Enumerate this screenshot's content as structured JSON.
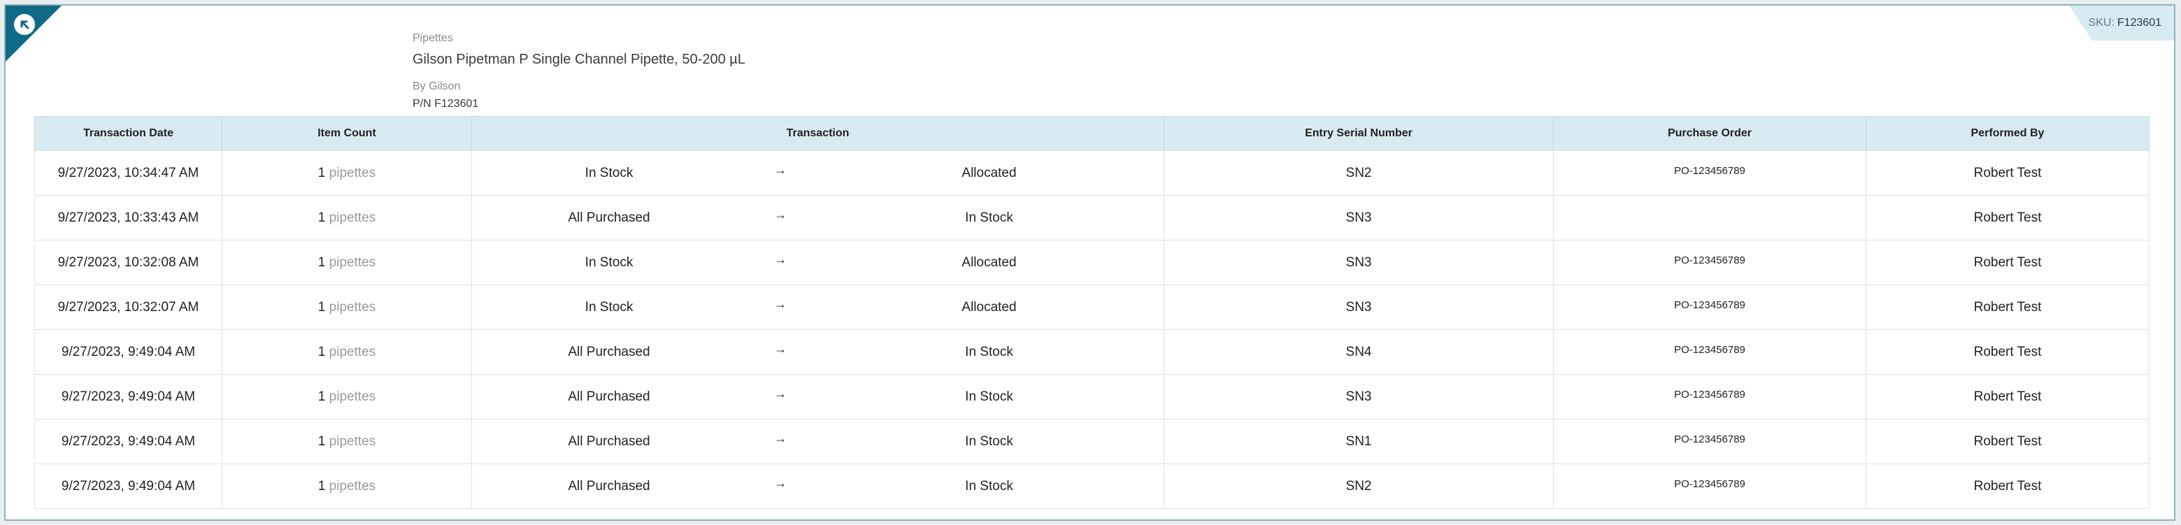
{
  "sku": {
    "label": "SKU:",
    "value": "F123601"
  },
  "product": {
    "category": "Pipettes",
    "name": "Gilson Pipetman P Single Channel Pipette, 50-200 µL",
    "by": "By Gilson",
    "pn": "P/N F123601"
  },
  "table": {
    "headers": [
      "Transaction Date",
      "Item Count",
      "Transaction",
      "Entry Serial Number",
      "Purchase Order",
      "Performed By"
    ],
    "rows": [
      {
        "date": "9/27/2023, 10:34:47 AM",
        "count": "1",
        "unit": "pipettes",
        "from": "In Stock",
        "arrow": "→",
        "to": "Allocated",
        "serial": "SN2",
        "po": "PO-123456789",
        "by": "Robert Test"
      },
      {
        "date": "9/27/2023, 10:33:43 AM",
        "count": "1",
        "unit": "pipettes",
        "from": "All Purchased",
        "arrow": "→",
        "to": "In Stock",
        "serial": "SN3",
        "po": "",
        "by": "Robert Test"
      },
      {
        "date": "9/27/2023, 10:32:08 AM",
        "count": "1",
        "unit": "pipettes",
        "from": "In Stock",
        "arrow": "→",
        "to": "Allocated",
        "serial": "SN3",
        "po": "PO-123456789",
        "by": "Robert Test"
      },
      {
        "date": "9/27/2023, 10:32:07 AM",
        "count": "1",
        "unit": "pipettes",
        "from": "In Stock",
        "arrow": "→",
        "to": "Allocated",
        "serial": "SN3",
        "po": "PO-123456789",
        "by": "Robert Test"
      },
      {
        "date": "9/27/2023, 9:49:04 AM",
        "count": "1",
        "unit": "pipettes",
        "from": "All Purchased",
        "arrow": "→",
        "to": "In Stock",
        "serial": "SN4",
        "po": "PO-123456789",
        "by": "Robert Test"
      },
      {
        "date": "9/27/2023, 9:49:04 AM",
        "count": "1",
        "unit": "pipettes",
        "from": "All Purchased",
        "arrow": "→",
        "to": "In Stock",
        "serial": "SN3",
        "po": "PO-123456789",
        "by": "Robert Test"
      },
      {
        "date": "9/27/2023, 9:49:04 AM",
        "count": "1",
        "unit": "pipettes",
        "from": "All Purchased",
        "arrow": "→",
        "to": "In Stock",
        "serial": "SN1",
        "po": "PO-123456789",
        "by": "Robert Test"
      },
      {
        "date": "9/27/2023, 9:49:04 AM",
        "count": "1",
        "unit": "pipettes",
        "from": "All Purchased",
        "arrow": "→",
        "to": "In Stock",
        "serial": "SN2",
        "po": "PO-123456789",
        "by": "Robert Test"
      }
    ]
  },
  "colors": {
    "accent": "#0f6a85",
    "header_bg": "#d9ebf2"
  },
  "icons": {
    "corner": "arrow-up-left-icon"
  }
}
